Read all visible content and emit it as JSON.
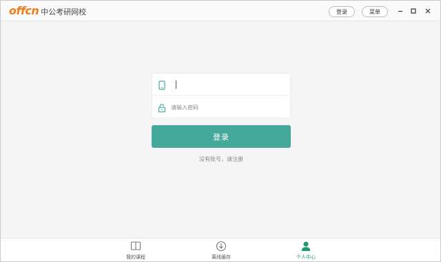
{
  "app": {
    "logo_mark": "offcn",
    "title": "中公考研网校"
  },
  "titlebar": {
    "login_label": "登录",
    "menu_label": "菜单"
  },
  "login_form": {
    "phone_value": "",
    "password_placeholder": "请输入密码",
    "submit_label": "登录",
    "register_link": "没有账号，请注册"
  },
  "bottom_nav": {
    "items": [
      {
        "label": "我的课程",
        "icon": "book-icon",
        "active": false
      },
      {
        "label": "离线缓存",
        "icon": "download-icon",
        "active": false
      },
      {
        "label": "个人中心",
        "icon": "person-icon",
        "active": true
      }
    ]
  },
  "colors": {
    "accent": "#44a99b",
    "active_tab": "#1f9a6c",
    "logo": "#f07c1c"
  }
}
